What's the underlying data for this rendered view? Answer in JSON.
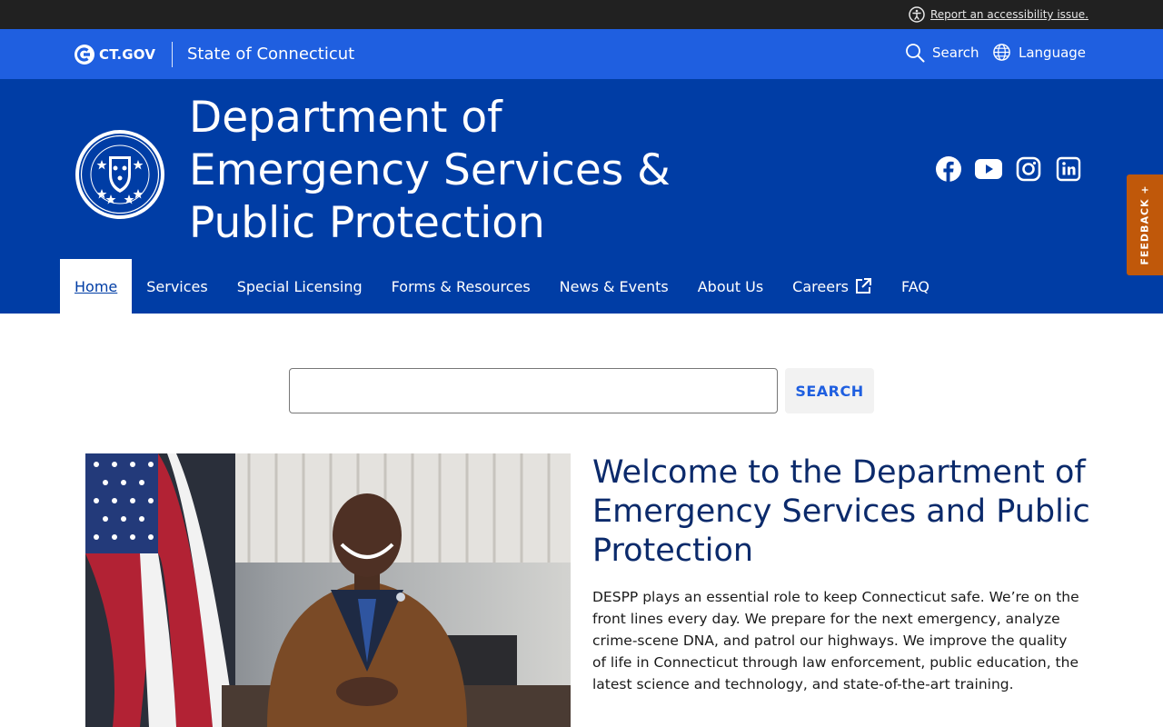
{
  "topbar": {
    "accessibility_link": "Report an accessibility issue."
  },
  "govbar": {
    "logo_text": "CT.GOV",
    "state_name": "State of Connecticut",
    "search_label": "Search",
    "language_label": "Language"
  },
  "header": {
    "title": "Department of Emergency Services & Public Protection",
    "social": [
      "facebook",
      "youtube",
      "instagram",
      "linkedin"
    ]
  },
  "nav": {
    "items": [
      {
        "label": "Home"
      },
      {
        "label": "Services"
      },
      {
        "label": "Special Licensing"
      },
      {
        "label": "Forms & Resources"
      },
      {
        "label": "News & Events"
      },
      {
        "label": "About Us"
      },
      {
        "label": "Careers"
      },
      {
        "label": "FAQ"
      }
    ]
  },
  "feedback": {
    "label": "FEEDBACK"
  },
  "search": {
    "value": "",
    "button_label": "SEARCH"
  },
  "main": {
    "welcome_title": "Welcome to the Department of Emergency Services and Public Protection",
    "intro": "DESPP plays an essential role to keep Connecticut safe. We’re on the front lines every day. We prepare for the next emergency, analyze crime-scene DNA, and patrol our highways. We improve the quality of life in Connecticut through law enforcement, public education, the latest science and technology, and state-of-the-art training."
  },
  "colors": {
    "topbar": "#212121",
    "govbar": "#1f5fe0",
    "header": "#003da5",
    "feedback": "#c0580a",
    "heading": "#0b2a6b"
  }
}
